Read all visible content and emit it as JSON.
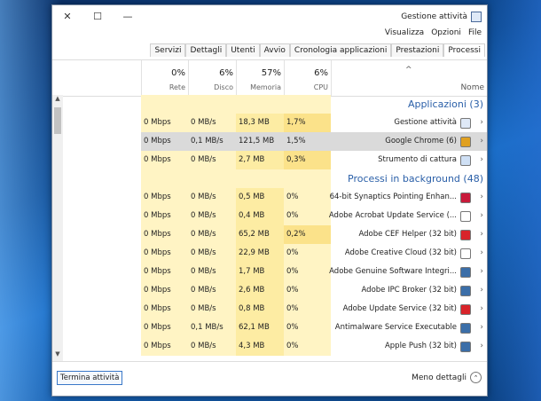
{
  "window": {
    "title": "Gestione attività",
    "controls": {
      "close": "✕",
      "maximize": "☐",
      "minimize": "—"
    }
  },
  "menu": [
    "File",
    "Opzioni",
    "Visualizza"
  ],
  "tabs": [
    "Processi",
    "Prestazioni",
    "Cronologia applicazioni",
    "Avvio",
    "Utenti",
    "Dettagli",
    "Servizi"
  ],
  "active_tab": "Processi",
  "columns": {
    "name": "Nome",
    "cpu": {
      "pct": "6%",
      "label": "CPU"
    },
    "memory": {
      "pct": "57%",
      "label": "Memoria"
    },
    "disk": {
      "pct": "6%",
      "label": "Disco"
    },
    "network": {
      "pct": "0%",
      "label": "Rete"
    }
  },
  "groups": {
    "apps": "Applicazioni (3)",
    "background": "Processi in background (48)"
  },
  "apps": [
    {
      "name": "Gestione attività",
      "cpu": "1,7%",
      "mem": "18,3 MB",
      "disk": "0 MB/s",
      "net": "0 Mbps",
      "icon": "taskmgr-icon",
      "color": "#dfe9f7"
    },
    {
      "name": "Google Chrome (6)",
      "cpu": "1,5%",
      "mem": "121,5 MB",
      "disk": "0,1 MB/s",
      "net": "0 Mbps",
      "icon": "chrome-icon",
      "color": "#e0a020"
    },
    {
      "name": "Strumento di cattura",
      "cpu": "0,3%",
      "mem": "2,7 MB",
      "disk": "0 MB/s",
      "net": "0 Mbps",
      "icon": "snipping-icon",
      "color": "#cfe0f5"
    }
  ],
  "background": [
    {
      "name": "64-bit Synaptics Pointing Enhan...",
      "cpu": "0%",
      "mem": "0,5 MB",
      "disk": "0 MB/s",
      "net": "0 Mbps",
      "icon": "synaptics-icon",
      "color": "#c81a3a"
    },
    {
      "name": "Adobe Acrobat Update Service (...",
      "cpu": "0%",
      "mem": "0,4 MB",
      "disk": "0 MB/s",
      "net": "0 Mbps",
      "icon": "window-icon",
      "color": "#ffffff"
    },
    {
      "name": "Adobe CEF Helper (32 bit)",
      "cpu": "0,2%",
      "mem": "65,2 MB",
      "disk": "0 MB/s",
      "net": "0 Mbps",
      "icon": "adobe-cc-icon",
      "color": "#d8242a"
    },
    {
      "name": "Adobe Creative Cloud (32 bit)",
      "cpu": "0%",
      "mem": "22,9 MB",
      "disk": "0 MB/s",
      "net": "0 Mbps",
      "icon": "creative-cloud-icon",
      "color": "#ffffff"
    },
    {
      "name": "Adobe Genuine Software Integri...",
      "cpu": "0%",
      "mem": "1,7 MB",
      "disk": "0 MB/s",
      "net": "0 Mbps",
      "icon": "service-icon",
      "color": "#3b6ea8"
    },
    {
      "name": "Adobe IPC Broker (32 bit)",
      "cpu": "0%",
      "mem": "2,6 MB",
      "disk": "0 MB/s",
      "net": "0 Mbps",
      "icon": "ipc-broker-icon",
      "color": "#3b6ea8"
    },
    {
      "name": "Adobe Update Service (32 bit)",
      "cpu": "0%",
      "mem": "0,8 MB",
      "disk": "0 MB/s",
      "net": "0 Mbps",
      "icon": "adobe-update-icon",
      "color": "#d8242a"
    },
    {
      "name": "Antimalware Service Executable",
      "cpu": "0%",
      "mem": "62,1 MB",
      "disk": "0,1 MB/s",
      "net": "0 Mbps",
      "icon": "service-icon",
      "color": "#3b6ea8"
    },
    {
      "name": "Apple Push (32 bit)",
      "cpu": "0%",
      "mem": "4,3 MB",
      "disk": "0 MB/s",
      "net": "0 Mbps",
      "icon": "service-icon",
      "color": "#3b6ea8"
    }
  ],
  "footer": {
    "less_details": "Meno dettagli",
    "end_task": "Termina attività"
  }
}
